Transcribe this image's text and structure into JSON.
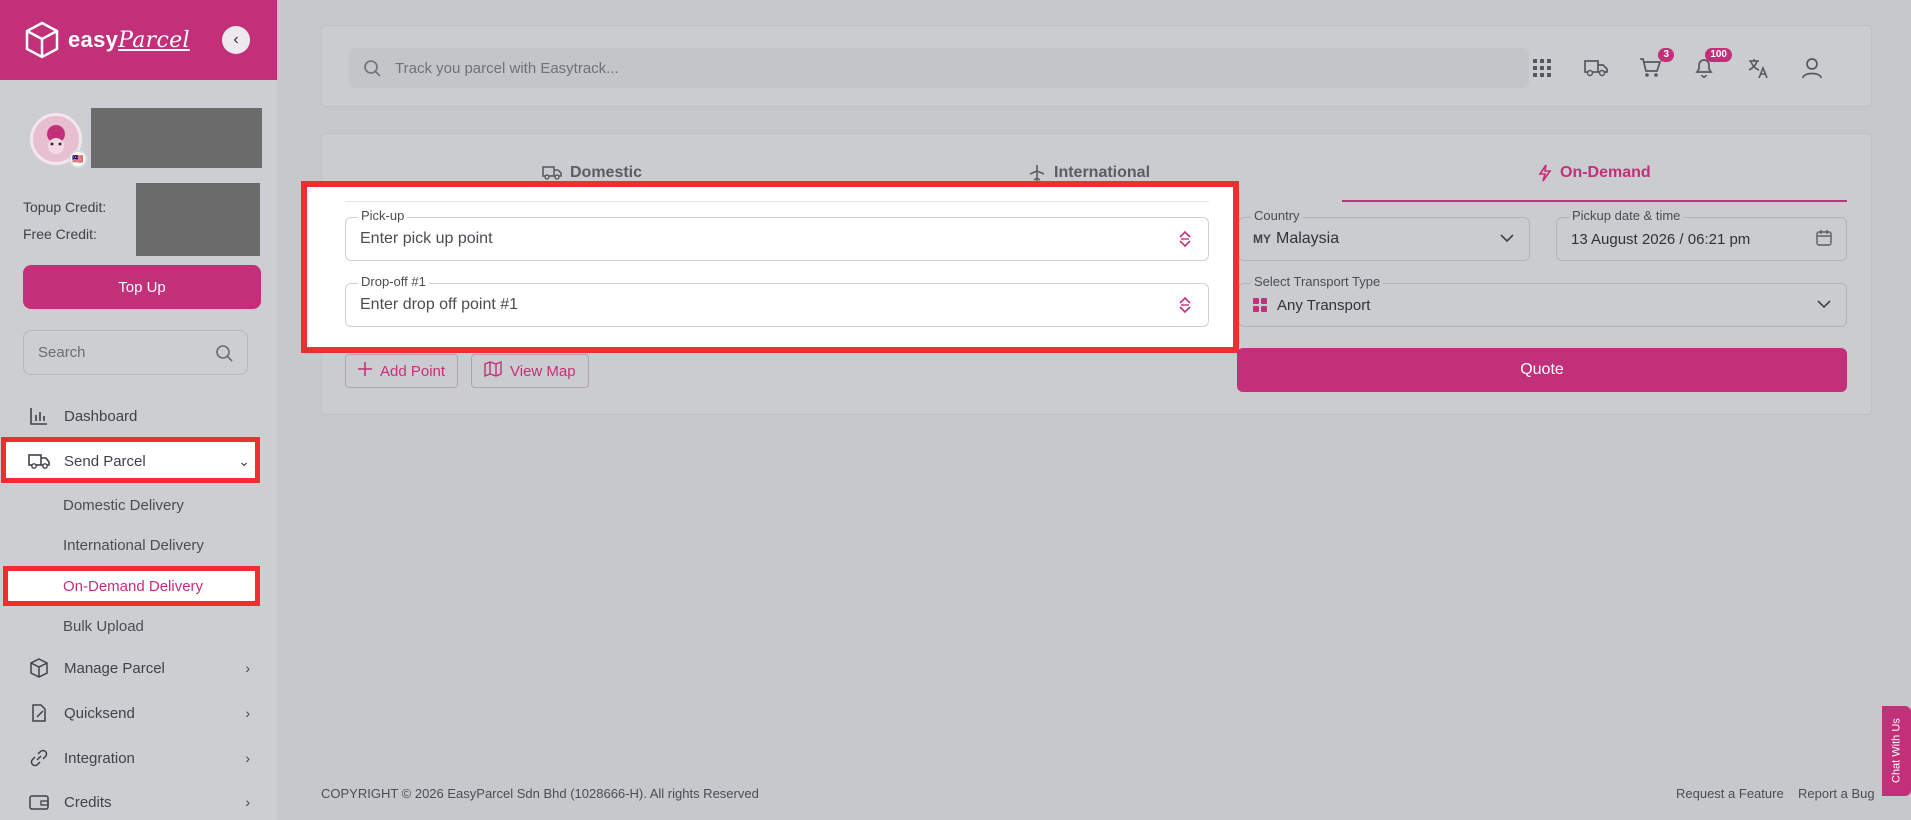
{
  "brand": {
    "name": "easy",
    "name_script": "Parcel"
  },
  "sidebar": {
    "topup_credit_label": "Topup Credit:",
    "free_credit_label": "Free Credit:",
    "topup_button": "Top Up",
    "search_placeholder": "Search",
    "nav": {
      "dashboard": "Dashboard",
      "send_parcel": "Send Parcel",
      "domestic": "Domestic Delivery",
      "international": "International Delivery",
      "on_demand": "On-Demand Delivery",
      "bulk": "Bulk Upload",
      "manage": "Manage Parcel",
      "quicksend": "Quicksend",
      "integration": "Integration",
      "credits": "Credits"
    }
  },
  "topbar": {
    "search_placeholder": "Track you parcel with Easytrack...",
    "cart_badge": "3",
    "notif_badge": "100"
  },
  "tabs": {
    "domestic": "Domestic",
    "international": "International",
    "on_demand": "On-Demand"
  },
  "form": {
    "pickup_label": "Pick-up",
    "pickup_placeholder": "Enter pick up point",
    "dropoff_label": "Drop-off #1",
    "dropoff_placeholder": "Enter drop off point #1",
    "country_label": "Country",
    "country_code": "MY",
    "country_value": "Malaysia",
    "date_label": "Pickup date & time",
    "date_value": "13 August 2026 / 06:21 pm",
    "transport_label": "Select Transport Type",
    "transport_value": "Any Transport",
    "add_point": "Add Point",
    "view_map": "View Map",
    "quote": "Quote"
  },
  "footer": {
    "copyright": "COPYRIGHT © 2026 EasyParcel Sdn Bhd (1028666-H). All rights Reserved",
    "request_feature": "Request a Feature",
    "report_bug": "Report a Bug"
  },
  "chat": "Chat With Us",
  "colors": {
    "brand": "#c3307a",
    "highlight": "#ef2f2f"
  }
}
